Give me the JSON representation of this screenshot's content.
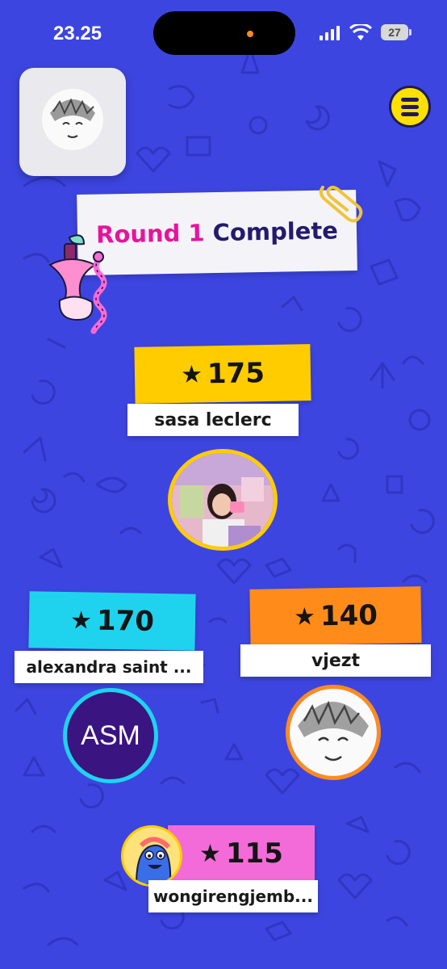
{
  "status_bar": {
    "time": "23.25",
    "battery": "27"
  },
  "round": {
    "label": "Round 1",
    "status": "Complete"
  },
  "players": [
    {
      "rank": 1,
      "score": "175",
      "name": "sasa leclerc",
      "tag_color": "#ffcc00"
    },
    {
      "rank": 2,
      "score": "170",
      "name": "alexandra saint ...",
      "initials": "ASM",
      "tag_color": "#1fd3ef"
    },
    {
      "rank": 3,
      "score": "140",
      "name": "vjezt",
      "tag_color": "#ff8c1a"
    },
    {
      "rank": 4,
      "score": "115",
      "name": "wongirengjemb...",
      "tag_color": "#f36bd8"
    }
  ],
  "icons": {
    "menu": "hamburger-menu-icon",
    "star": "star-icon",
    "paperclip": "paperclip-icon",
    "apple": "apple-core-worm-icon"
  },
  "colors": {
    "background": "#3d45e0",
    "round_label": "#e8139c",
    "round_status": "#241a6e",
    "menu_button": "#ffe000"
  }
}
